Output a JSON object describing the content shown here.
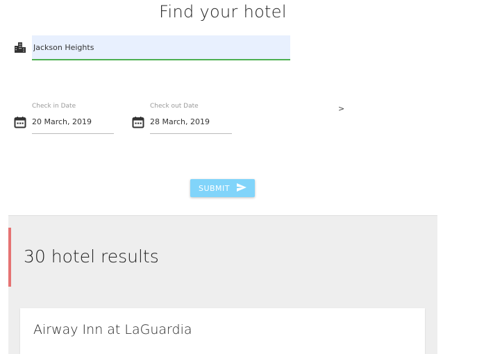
{
  "page": {
    "title": "Find your hotel"
  },
  "search": {
    "location_value": "Jackson Heights"
  },
  "dates": {
    "checkin_label": "Check in Date",
    "checkin_value": "20 March, 2019",
    "checkout_label": "Check out Date",
    "checkout_value": "28 March, 2019"
  },
  "misc": {
    "chevron_text": ">"
  },
  "actions": {
    "submit_label": "SUBMIT"
  },
  "results": {
    "count_text": "30 hotel results",
    "accent_color": "#e57373",
    "items": [
      {
        "name": "Airway Inn at LaGuardia"
      }
    ]
  },
  "colors": {
    "button": "#81d4fa",
    "field_active": "#4caf50",
    "field_bg": "#e8f0fe"
  },
  "icons": {
    "location": "city-icon",
    "date": "calendar-icon",
    "submit": "send-icon"
  }
}
